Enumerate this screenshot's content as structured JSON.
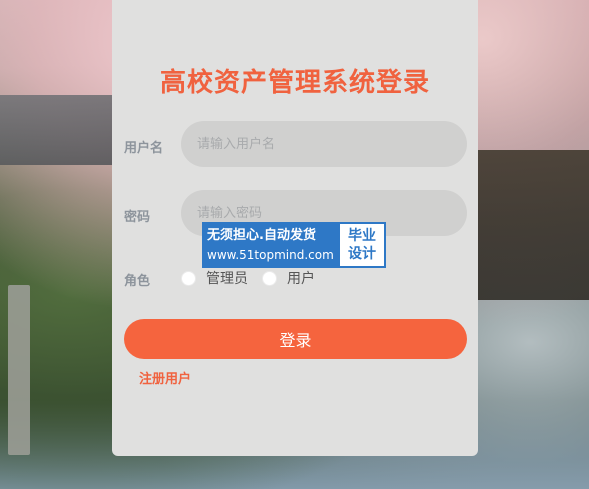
{
  "title": "高校资产管理系统登录",
  "form": {
    "username_label": "用户名",
    "username_placeholder": "请输入用户名",
    "password_label": "密码",
    "password_placeholder": "请输入密码",
    "role_label": "角色",
    "role_options": [
      "管理员",
      "用户"
    ],
    "login_button": "登录",
    "register_link": "注册用户"
  },
  "watermark": {
    "line1": "无须担心.自动发货",
    "line2": "www.51topmind.com",
    "badge_line1": "毕业",
    "badge_line2": "设计"
  },
  "colors": {
    "accent": "#f5643e",
    "title": "#f0623f",
    "panel": "#e0e0df",
    "input_bg": "#d0d0cf",
    "watermark_blue": "#2e78c6"
  }
}
